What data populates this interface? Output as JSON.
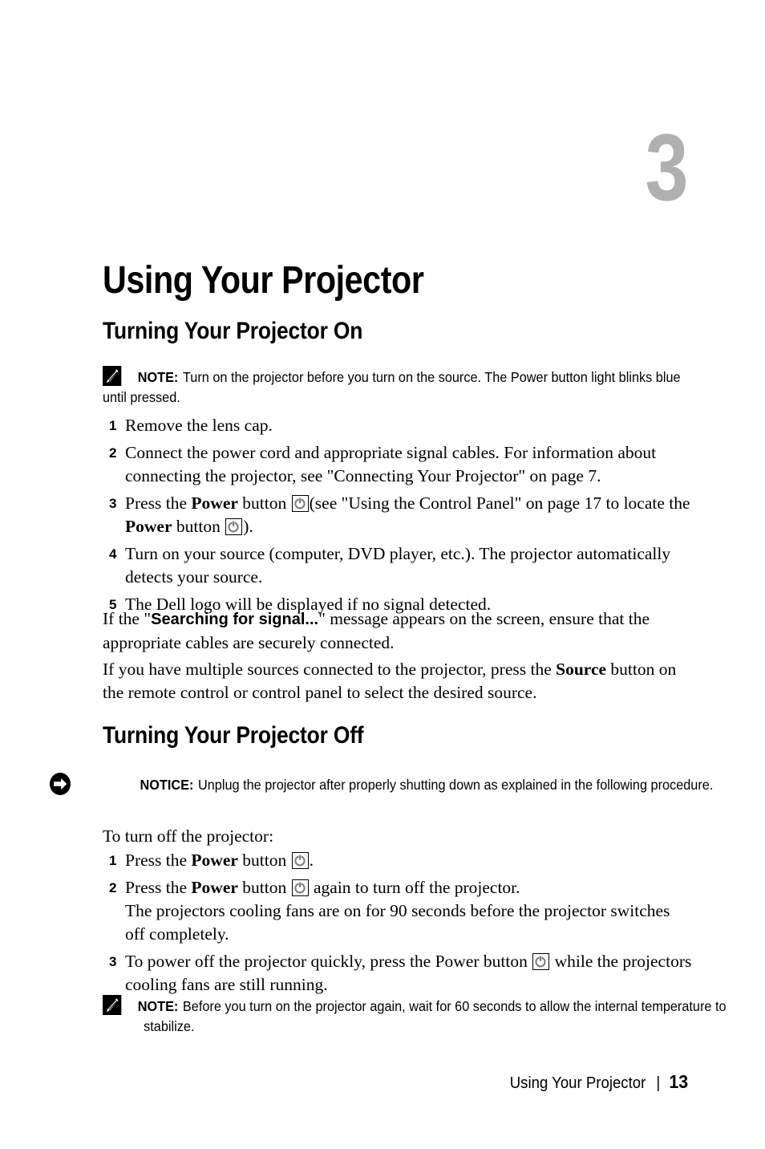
{
  "chapter": {
    "number": "3",
    "title": "Using Your Projector"
  },
  "sections": {
    "on": {
      "heading": "Turning Your Projector On",
      "note": {
        "icon": "note-pencil-icon",
        "label": "NOTE:",
        "text": "Turn on the projector before you turn on the source. The Power button light blinks blue until pressed."
      },
      "steps": [
        {
          "num": "1",
          "text": "Remove the lens cap."
        },
        {
          "num": "2",
          "text": "Connect the power cord and appropriate signal cables. For information about connecting the projector, see \"Connecting Your Projector\" on page 7."
        },
        {
          "num": "3",
          "pre": "Press the ",
          "bold1": "Power",
          "mid1": " button ",
          "mid2": "(see \"Using the Control Panel\" on page 17 to locate the ",
          "bold2": "Power",
          "mid3": " button ",
          "post": ")."
        },
        {
          "num": "4",
          "text": "Turn on your source (computer, DVD player, etc.). The projector automatically detects your source."
        },
        {
          "num": "5",
          "text": "The Dell logo will be displayed if no signal detected."
        }
      ],
      "paragraph1": {
        "pre": "If the \"",
        "bold": "Searching for signal...",
        "post": "\" message appears on the screen, ensure that the appropriate cables are securely connected."
      },
      "paragraph2": {
        "pre": "If you have multiple sources connected to the projector, press the ",
        "bold": "Source",
        "post": " button on the remote control or control panel to select the desired source."
      }
    },
    "off": {
      "heading": "Turning Your Projector Off",
      "notice": {
        "icon": "notice-arrow-icon",
        "label": "NOTICE:",
        "text": "Unplug the projector after properly shutting down as explained in the following procedure."
      },
      "intro": "To turn off the projector:",
      "steps": [
        {
          "num": "1",
          "pre": "Press the ",
          "bold": "Power",
          "mid": " button ",
          "post": "."
        },
        {
          "num": "2",
          "pre": "Press the ",
          "bold": "Power",
          "mid": " button ",
          "post": " again to turn off the projector.",
          "extra": "The projectors cooling fans are on for 90 seconds before the projector switches off completely."
        },
        {
          "num": "3",
          "pre": "To power off the projector quickly, press the Power button ",
          "post": " while the projectors cooling fans are still running."
        }
      ],
      "note": {
        "icon": "note-pencil-icon",
        "label": "NOTE:",
        "text": "Before you turn on the projector again, wait for 60 seconds to allow the internal temperature to stabilize."
      }
    }
  },
  "footer": {
    "title": "Using Your Projector",
    "separator": "|",
    "page": "13"
  },
  "colors": {
    "chapter_number": "#b0b0b0",
    "text": "#000000",
    "power_glyph": "#808080",
    "background": "#ffffff"
  }
}
